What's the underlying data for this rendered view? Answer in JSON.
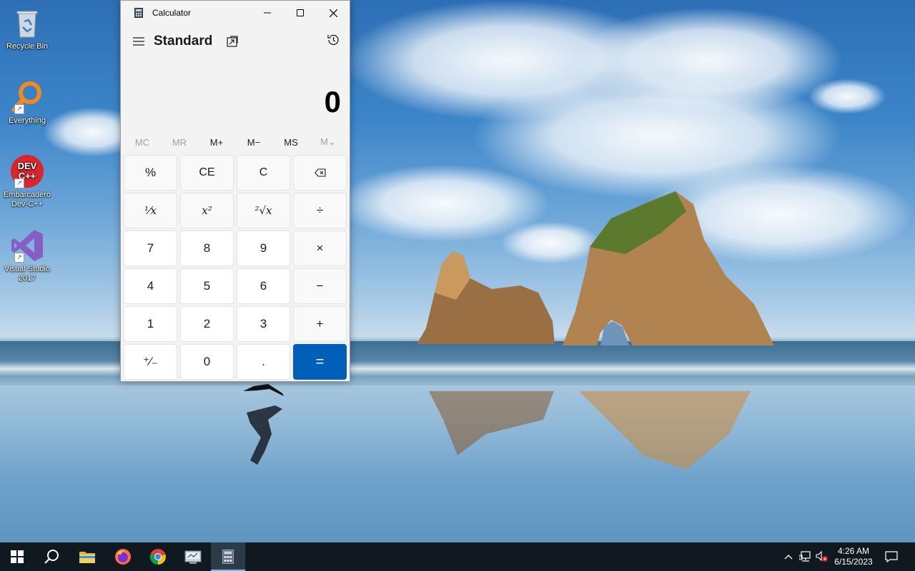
{
  "desktop": {
    "icons": [
      {
        "label": "Recycle Bin",
        "icon": "recycle-bin-icon"
      },
      {
        "label": "Everything",
        "icon": "everything-search-icon"
      },
      {
        "label": "Embarcadero Dev-C++",
        "icon": "devcpp-icon",
        "logo_text": "DEV C++"
      },
      {
        "label": "Visual Studio 2017",
        "icon": "visual-studio-icon"
      }
    ]
  },
  "calculator": {
    "window_title": "Calculator",
    "mode": "Standard",
    "display_value": "0",
    "memory": [
      {
        "label": "MC",
        "enabled": false
      },
      {
        "label": "MR",
        "enabled": false
      },
      {
        "label": "M+",
        "enabled": true
      },
      {
        "label": "M−",
        "enabled": true
      },
      {
        "label": "MS",
        "enabled": true
      },
      {
        "label": "M⌄",
        "enabled": false
      }
    ],
    "keys": {
      "percent": "%",
      "ce": "CE",
      "c": "C",
      "reciprocal": "¹⁄x",
      "square": "x²",
      "sqrt": "²√x",
      "divide": "÷",
      "seven": "7",
      "eight": "8",
      "nine": "9",
      "multiply": "×",
      "four": "4",
      "five": "5",
      "six": "6",
      "subtract": "−",
      "one": "1",
      "two": "2",
      "three": "3",
      "add": "+",
      "negate": "⁺⁄₋",
      "zero": "0",
      "decimal": ".",
      "equals": "="
    },
    "accent_color": "#005fb8"
  },
  "taskbar": {
    "items": [
      "start-icon",
      "search-icon",
      "file-explorer-icon",
      "firefox-icon",
      "chrome-icon",
      "app-icon",
      "calculator-icon"
    ],
    "clock_time": "4:26 AM",
    "clock_date": "6/15/2023"
  }
}
